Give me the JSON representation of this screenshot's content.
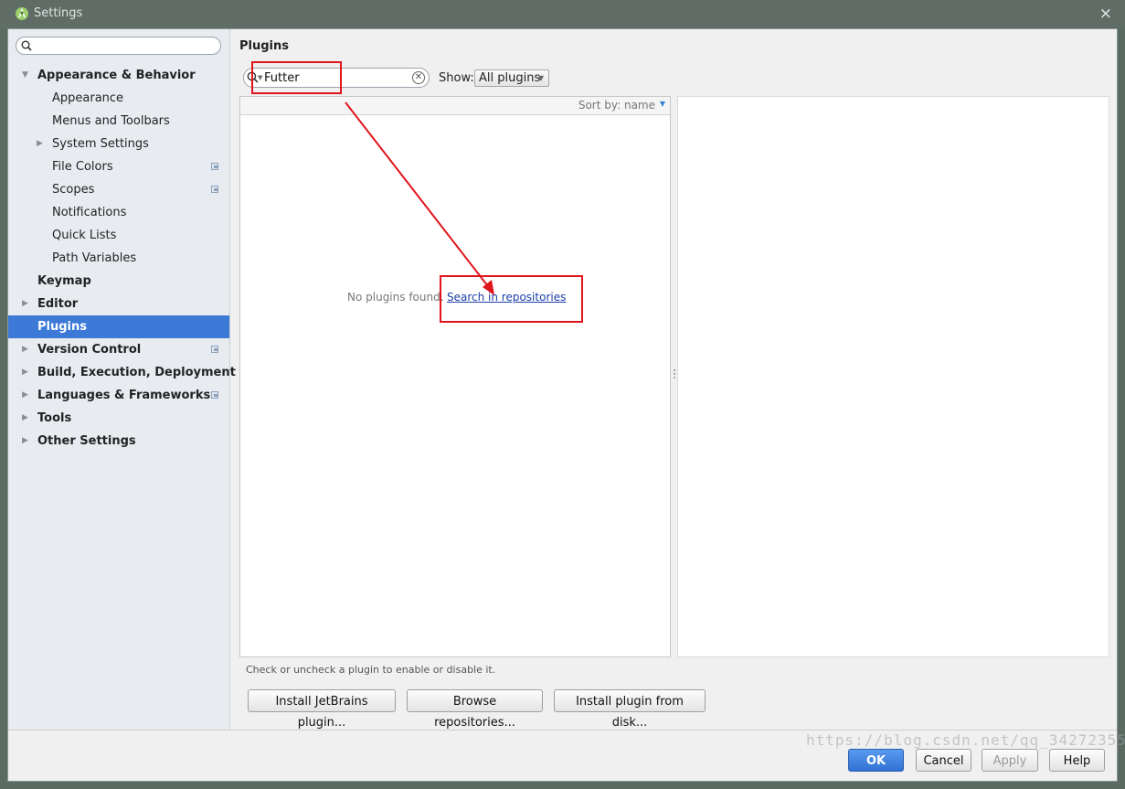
{
  "window": {
    "title": "Settings",
    "close_glyph": "×"
  },
  "sidebar": {
    "search_placeholder": "",
    "items": [
      {
        "label": "Appearance & Behavior",
        "level": 0,
        "bold": true,
        "expanded": true,
        "icon": "arrow-down"
      },
      {
        "label": "Appearance",
        "level": 1
      },
      {
        "label": "Menus and Toolbars",
        "level": 1
      },
      {
        "label": "System Settings",
        "level": 1,
        "icon": "arrow-right"
      },
      {
        "label": "File Colors",
        "level": 1,
        "project": true
      },
      {
        "label": "Scopes",
        "level": 1,
        "project": true
      },
      {
        "label": "Notifications",
        "level": 1
      },
      {
        "label": "Quick Lists",
        "level": 1
      },
      {
        "label": "Path Variables",
        "level": 1
      },
      {
        "label": "Keymap",
        "level": 0,
        "bold": true
      },
      {
        "label": "Editor",
        "level": 0,
        "bold": true,
        "icon": "arrow-right"
      },
      {
        "label": "Plugins",
        "level": 0,
        "bold": true,
        "selected": true
      },
      {
        "label": "Version Control",
        "level": 0,
        "bold": true,
        "icon": "arrow-right",
        "project": true
      },
      {
        "label": "Build, Execution, Deployment",
        "level": 0,
        "bold": true,
        "icon": "arrow-right"
      },
      {
        "label": "Languages & Frameworks",
        "level": 0,
        "bold": true,
        "icon": "arrow-right",
        "project": true
      },
      {
        "label": "Tools",
        "level": 0,
        "bold": true,
        "icon": "arrow-right"
      },
      {
        "label": "Other Settings",
        "level": 0,
        "bold": true,
        "icon": "arrow-right"
      }
    ]
  },
  "plugins": {
    "heading": "Plugins",
    "search_value": "Futter",
    "show_label": "Show:",
    "show_value": "All plugins",
    "sort_label": "Sort by: name",
    "empty_text": "No plugins found.",
    "search_link": "Search in repositories",
    "hint": "Check or uncheck a plugin to enable or disable it.",
    "buttons": {
      "install_jetbrains": "Install JetBrains plugin...",
      "browse": "Browse repositories...",
      "install_disk": "Install plugin from disk..."
    }
  },
  "footer": {
    "ok": "OK",
    "cancel": "Cancel",
    "apply": "Apply",
    "help": "Help"
  },
  "watermark": "https://blog.csdn.net/qq_34272355",
  "colors": {
    "selection": "#3d79d7",
    "annotation": "#e0141b",
    "ok_button": "#2f71d4"
  }
}
